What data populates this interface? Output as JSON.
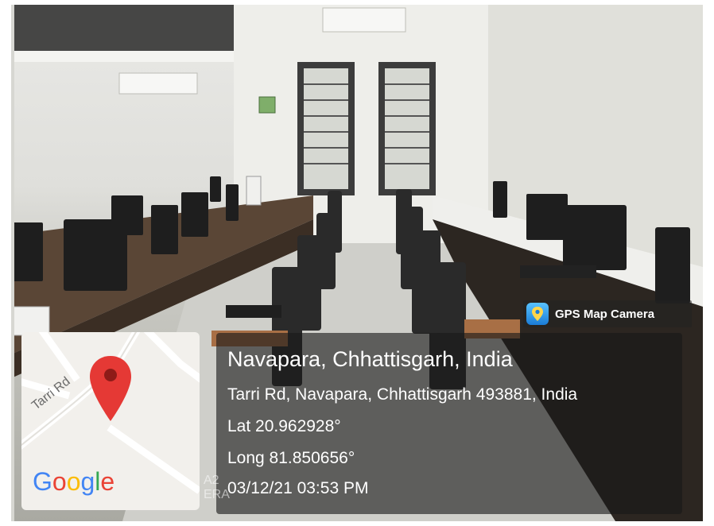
{
  "overlay": {
    "badge_label": "GPS Map Camera",
    "place_title": "Navapara, Chhattisgarh, India",
    "address": "Tarri Rd, Navapara, Chhattisgarh 493881, India",
    "latitude": "Lat 20.962928°",
    "longitude": "Long 81.850656°",
    "timestamp": "03/12/21 03:53 PM"
  },
  "map": {
    "road_label": "Tarri Rd",
    "brand_g1": "G",
    "brand_o1": "o",
    "brand_o2": "o",
    "brand_g2": "g",
    "brand_l": "l",
    "brand_e": "e",
    "pin_color": "#E53935"
  },
  "watermark": {
    "line1": "A2",
    "line2": "ERA"
  }
}
